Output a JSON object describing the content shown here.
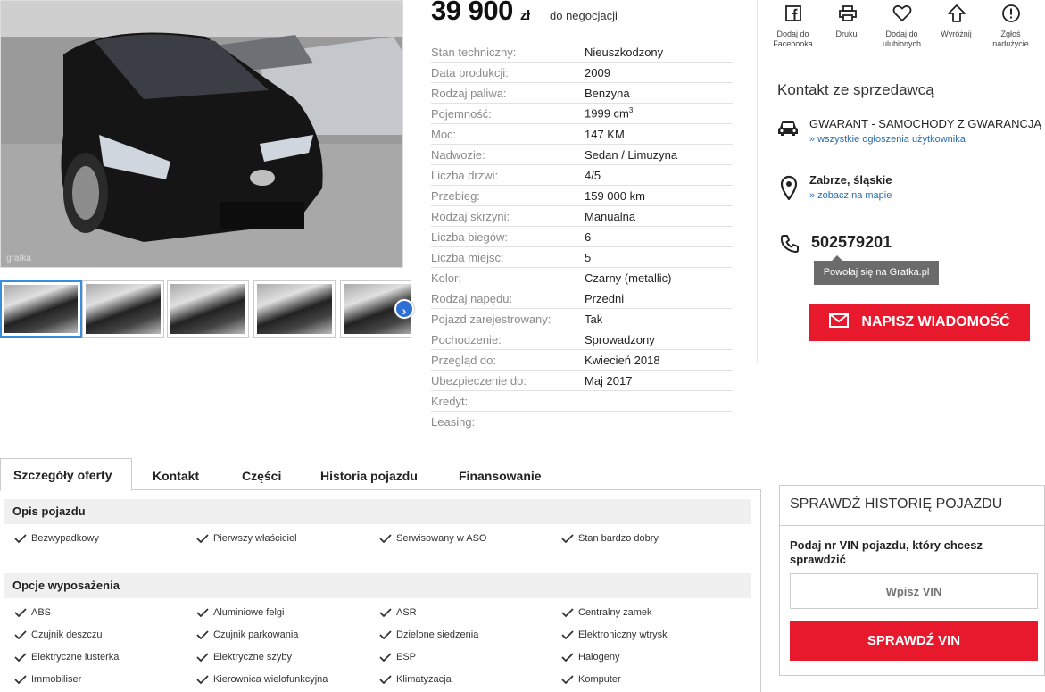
{
  "gallery": {
    "watermark": "gratka"
  },
  "price": {
    "amount": "39 900",
    "currency": "zł",
    "negotiable": "do negocjacji"
  },
  "params": [
    {
      "label": "Stan techniczny:",
      "value": "Nieuszkodzony"
    },
    {
      "label": "Data produkcji:",
      "value": "2009"
    },
    {
      "label": "Rodzaj paliwa:",
      "value": "Benzyna"
    },
    {
      "label": "Pojemność:",
      "value": "1999 cm",
      "sup": "3"
    },
    {
      "label": "Moc:",
      "value": "147 KM"
    },
    {
      "label": "Nadwozie:",
      "value": "Sedan / Limuzyna"
    },
    {
      "label": "Liczba drzwi:",
      "value": "4/5"
    },
    {
      "label": "Przebieg:",
      "value": "159 000 km"
    },
    {
      "label": "Rodzaj skrzyni:",
      "value": "Manualna"
    },
    {
      "label": "Liczba biegów:",
      "value": "6"
    },
    {
      "label": "Liczba miejsc:",
      "value": "5"
    },
    {
      "label": "Kolor:",
      "value": "Czarny (metallic)"
    },
    {
      "label": "Rodzaj napędu:",
      "value": "Przedni"
    },
    {
      "label": "Pojazd zarejestrowany:",
      "value": "Tak"
    },
    {
      "label": "Pochodzenie:",
      "value": "Sprowadzony"
    },
    {
      "label": "Przegląd do:",
      "value": "Kwiecień 2018"
    },
    {
      "label": "Ubezpieczenie do:",
      "value": "Maj 2017"
    },
    {
      "label": "Kredyt:",
      "value": ""
    },
    {
      "label": "Leasing:",
      "value": ""
    }
  ],
  "actions": [
    {
      "line1": "Dodaj do",
      "line2": "Facebooka",
      "icon": "facebook-icon"
    },
    {
      "line1": "Drukuj",
      "line2": "",
      "icon": "printer-icon"
    },
    {
      "line1": "Dodaj do",
      "line2": "ulubionych",
      "icon": "heart-icon"
    },
    {
      "line1": "Wyróżnij",
      "line2": "",
      "icon": "arrow-up-icon"
    },
    {
      "line1": "Zgłoś",
      "line2": "nadużycie",
      "icon": "alert-icon"
    }
  ],
  "contact": {
    "title": "Kontakt ze sprzedawcą",
    "seller": "GWARANT - SAMOCHODY Z GWARANCJĄ",
    "seller_link": "» wszystkie ogłoszenia użytkownika",
    "location": "Zabrze, śląskie",
    "location_link": "» zobacz na mapie",
    "phone": "502579201",
    "tooltip": "Powołaj się na Gratka.pl",
    "message_button": "NAPISZ WIADOMOŚĆ"
  },
  "tabs": [
    "Szczegóły oferty",
    "Kontakt",
    "Części",
    "Historia pojazdu",
    "Finansowanie"
  ],
  "sections": {
    "description": {
      "title": "Opis pojazdu",
      "items": [
        "Bezwypadkowy",
        "Pierwszy właściciel",
        "Serwisowany w ASO",
        "Stan bardzo dobry"
      ]
    },
    "equipment": {
      "title": "Opcje wyposażenia",
      "items": [
        "ABS",
        "Aluminiowe felgi",
        "ASR",
        "Centralny zamek",
        "Czujnik deszczu",
        "Czujnik parkowania",
        "Dzielone siedzenia",
        "Elektroniczny wtrysk",
        "Elektryczne lusterka",
        "Elektryczne szyby",
        "ESP",
        "Halogeny",
        "Immobiliser",
        "Kierownica wielofunkcyjna",
        "Klimatyzacja",
        "Komputer"
      ]
    }
  },
  "vin": {
    "title": "SPRAWDŹ HISTORIĘ POJAZDU",
    "description": "Podaj nr VIN pojazdu, który chcesz sprawdzić",
    "placeholder": "Wpisz VIN",
    "button": "SPRAWDŹ VIN"
  },
  "colors": {
    "accent_red": "#e8192c",
    "link_blue": "#2b6cb0",
    "thumb_active": "#3b8de0"
  }
}
